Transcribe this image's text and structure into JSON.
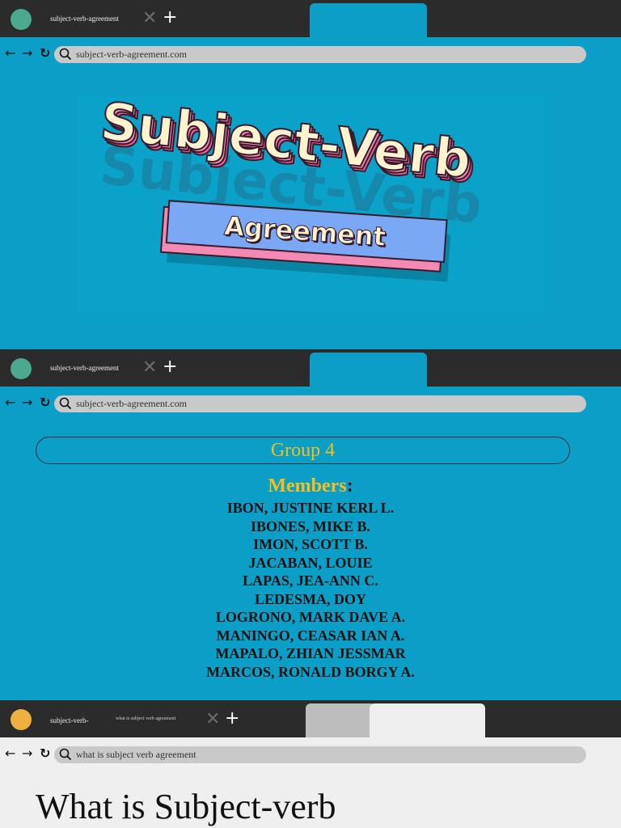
{
  "colors": {
    "teal_background": "#0b9fc7",
    "tab_bar": "#2b2b2b",
    "url_bar": "#c9c9c9",
    "green_dot": "#4aa98e",
    "orange_dot": "#f0b040",
    "yellow_text": "#f2c01e",
    "pink_title": "#f28ab4",
    "cream_title": "#fdf3cf",
    "blue_badge": "#7aa8f4"
  },
  "screen1": {
    "tab_title": "subject-verb-agreement",
    "close_icon": "✕",
    "new_tab_icon": "+",
    "back_icon": "←",
    "forward_icon": "→",
    "reload_icon": "↻",
    "url": "subject-verb-agreement.com",
    "title_line1": "Subject-Verb",
    "title_line2": "Agreement"
  },
  "screen2": {
    "tab_title": "subject-verb-agreement",
    "close_icon": "✕",
    "new_tab_icon": "+",
    "back_icon": "←",
    "forward_icon": "→",
    "reload_icon": "↻",
    "url": "subject-verb-agreement.com",
    "group_label": "Group 4",
    "members_label": "Members",
    "members_colon": ":",
    "members": [
      "IBON, JUSTINE KERL L.",
      "IBONES, MIKE B.",
      "IMON, SCOTT B.",
      "JACABAN, LOUIE",
      "LAPAS, JEA-ANN C.",
      "LEDESMA, DOY",
      "LOGRONO, MARK DAVE A.",
      "MANINGO, CEASAR IAN A.",
      "MAPALO, ZHIAN JESSMAR",
      "MARCOS, RONALD BORGY A."
    ]
  },
  "screen3": {
    "tab_title": "subject-verb-",
    "tab_subtitle": "what is subject verb agreement",
    "close_icon": "✕",
    "new_tab_icon": "+",
    "back_icon": "←",
    "forward_icon": "→",
    "reload_icon": "↻",
    "search_query": "what is subject verb agreement",
    "heading": "What is Subject-verb"
  }
}
